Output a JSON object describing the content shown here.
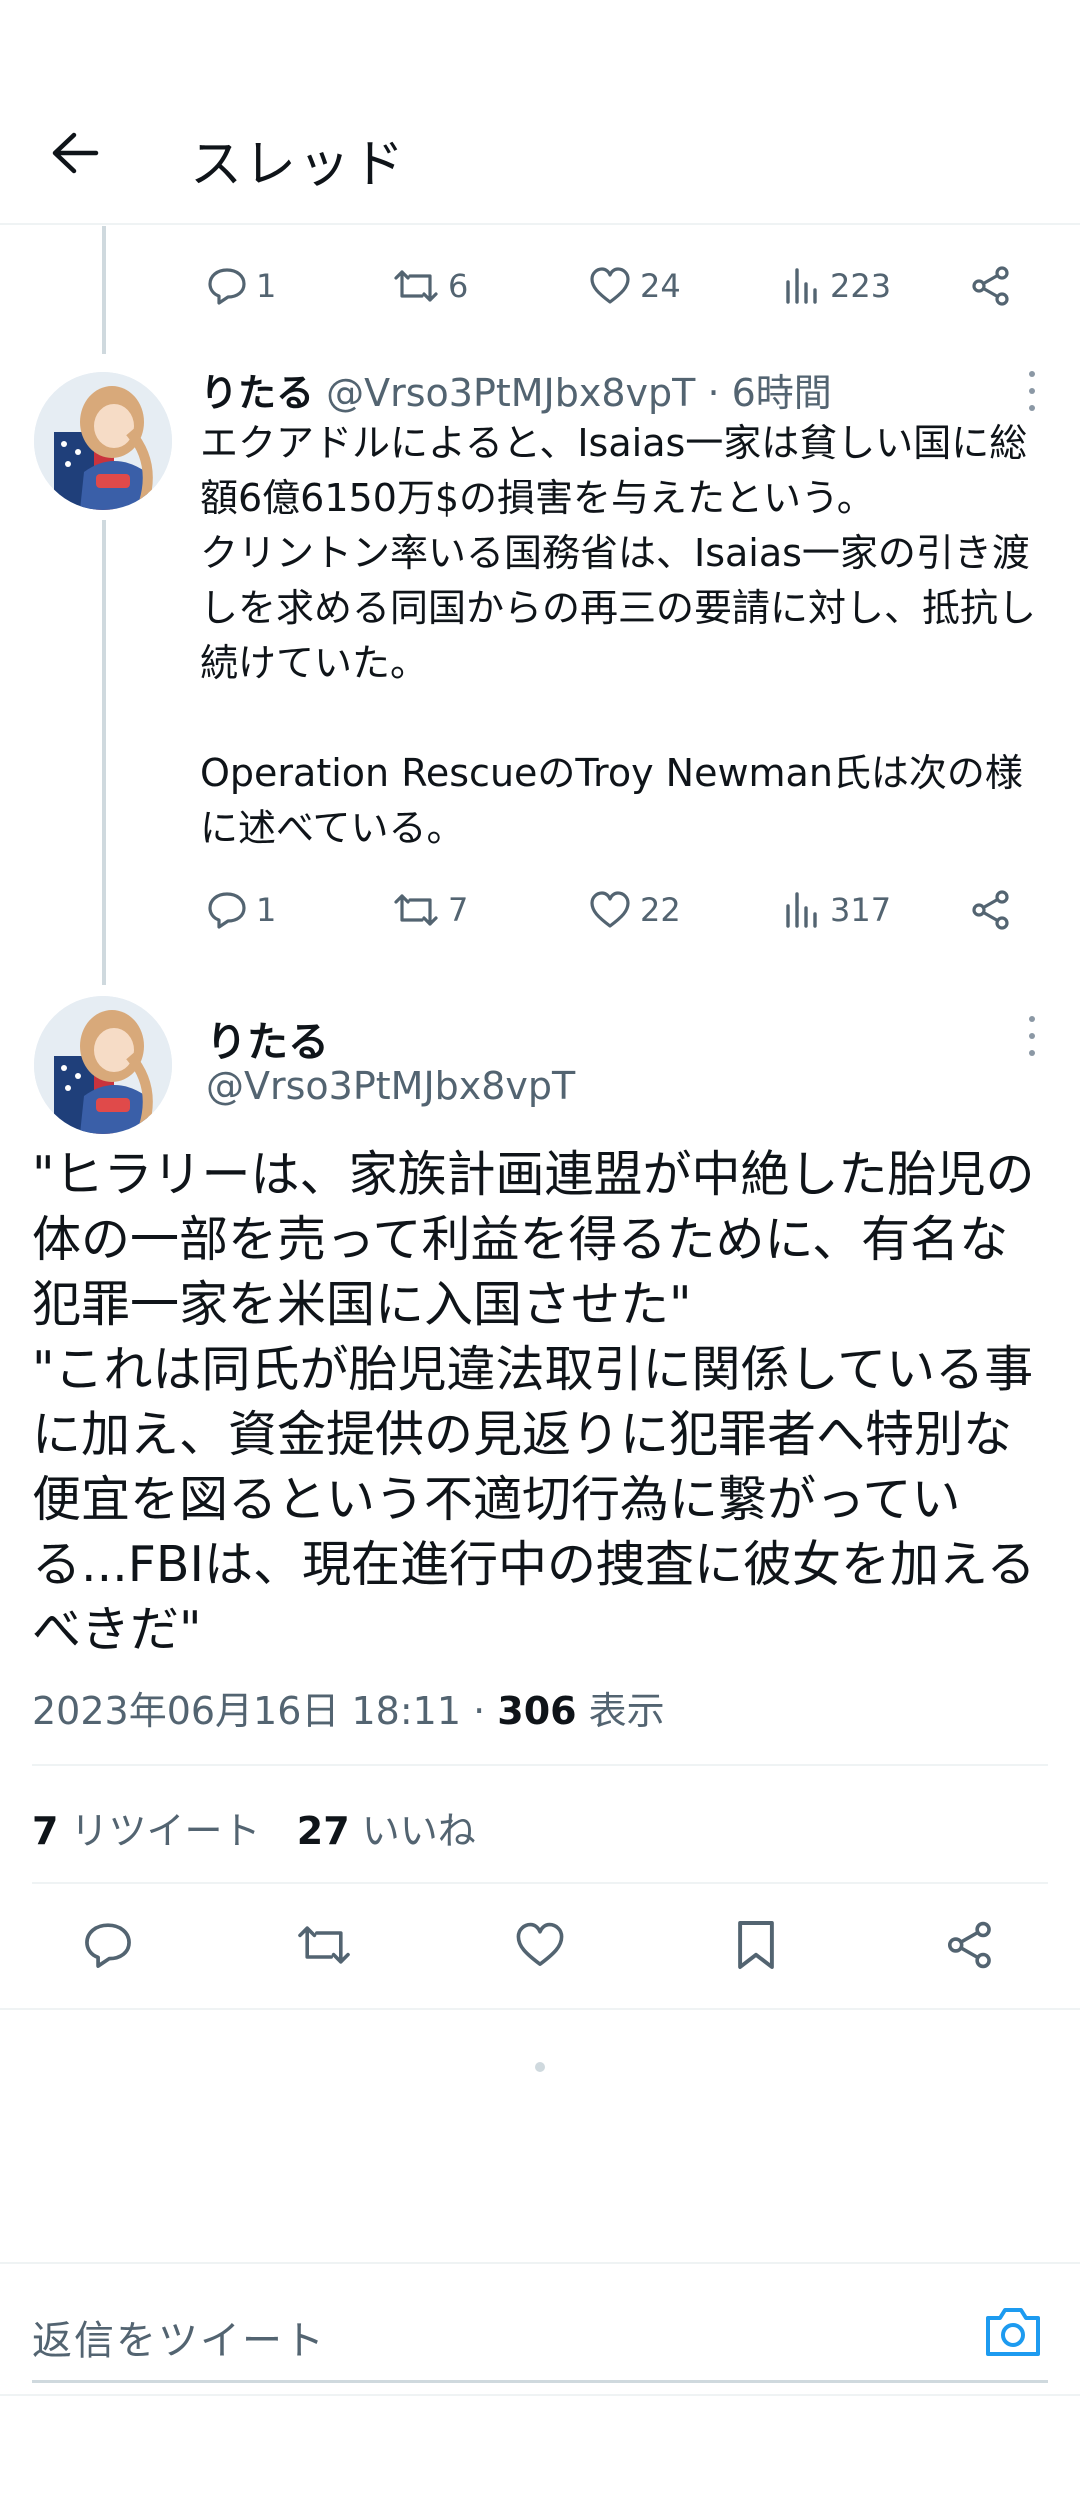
{
  "header": {
    "title": "スレッド"
  },
  "tweet1": {
    "actions": {
      "replies": "1",
      "retweets": "6",
      "likes": "24",
      "views": "223"
    }
  },
  "tweet2": {
    "name": "りたる",
    "handle": "@Vrso3PtMJbx8vpT",
    "time": "· 6時間",
    "body": "エクアドルによると、Isaias一家は貧しい国に総額6億6150万$の損害を与えたという。\nクリントン率いる国務省は、Isaias一家の引き渡しを求める同国からの再三の要請に対し、抵抗し続けていた。\n\nOperation RescueのTroy Newman氏は次の様に述べている。",
    "actions": {
      "replies": "1",
      "retweets": "7",
      "likes": "22",
      "views": "317"
    }
  },
  "main_tweet": {
    "name": "りたる",
    "handle": "@Vrso3PtMJbx8vpT",
    "body": "\"ヒラリーは、家族計画連盟が中絶した胎児の体の一部を売って利益を得るために、有名な犯罪一家を米国に入国させた\"\n\"これは同氏が胎児違法取引に関係している事に加え、資金提供の見返りに犯罪者へ特別な便宜を図るという不適切行為に繋がっている...FBIは、現在進行中の捜査に彼女を加えるべきだ\"",
    "timestamp": "2023年06月16日 18:11 · ",
    "view_count": "306",
    "view_label": " 表示",
    "retweet_count": "7",
    "retweet_label": " リツイート",
    "like_count": "27",
    "like_label": " いいね"
  },
  "reply": {
    "placeholder": "返信をツイート"
  },
  "colors": {
    "accent": "#1d9bf0",
    "muted": "#536471",
    "text": "#0f1419",
    "border": "#eff3f4"
  }
}
